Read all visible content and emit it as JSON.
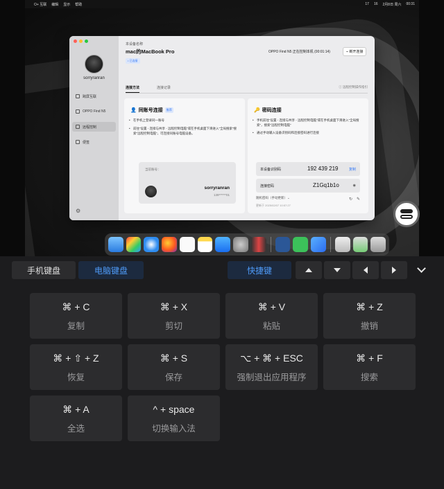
{
  "menubar": {
    "apple": "",
    "app": "O+ 互联",
    "menus": [
      "编辑",
      "显示",
      "帮助"
    ],
    "status": [
      "17",
      "16",
      "2月8日 周六",
      "00:31"
    ]
  },
  "window": {
    "device_label": "本设备名称",
    "device_name": "mac的MacBook Pro",
    "device_tag": "• 已连接",
    "control_status": "OPPO Find N5 正在控制本机 (00:01:14)",
    "disconnect_label": "⌁ 断开连接",
    "sidebar": {
      "user": "sorryranran",
      "items": [
        {
          "label": "跨屏互联"
        },
        {
          "label": "OPPO Find N5"
        },
        {
          "label": "远程控制"
        },
        {
          "label": "便签"
        }
      ]
    },
    "tabs": [
      "连接方法",
      "连接记录"
    ],
    "help": "ⓘ 远程控制操作指引",
    "same_account": {
      "title": "同账号连接",
      "badge": "推荐",
      "bullets": [
        "在手机上登录同一账号",
        "前往“设置 - 连接与共享 - 远程控制电脑”或在手机桌面下滑进入“全局搜索”搜索“远程控制电脑”，可连接同账号电脑设备。"
      ],
      "current_label": "当前账号：",
      "account_name": "sorryranran",
      "account_phone": "139******01"
    },
    "password": {
      "title": "密码连接",
      "bullets": [
        "手机前往“设置 - 连接与共享 - 远程控制电脑”或在手机桌面下滑进入“全局搜索”，搜索“远程控制电脑”",
        "通过手动输入设备识别码和连接密码进行连接"
      ],
      "id_label": "本设备识别码",
      "id_value": "192 439 219",
      "copy_label": "复制",
      "pw_label": "连接密码",
      "pw_value": "Z1Gq1b1o",
      "pw_option": "随机密码（手动更新）⌄",
      "pw_time": "更新于 2025/02/07 10:57:27"
    }
  },
  "toolbar": {
    "phone_keyboard": "手机键盘",
    "pc_keyboard": "电脑键盘",
    "shortcuts": "快捷键"
  },
  "keys": [
    {
      "combo": "⌘ + C",
      "desc": "复制"
    },
    {
      "combo": "⌘ + X",
      "desc": "剪切"
    },
    {
      "combo": "⌘ + V",
      "desc": "粘贴"
    },
    {
      "combo": "⌘ + Z",
      "desc": "撤销"
    },
    {
      "combo": "⌘ + ⇧ + Z",
      "desc": "恢复"
    },
    {
      "combo": "⌘ + S",
      "desc": "保存"
    },
    {
      "combo": "⌥ + ⌘ + ESC",
      "desc": "强制退出应用程序"
    },
    {
      "combo": "⌘ + F",
      "desc": "搜索"
    },
    {
      "combo": "⌘ + A",
      "desc": "全选"
    },
    {
      "combo": "^ + space",
      "desc": "切换输入法"
    }
  ],
  "colors": {
    "accent": "#4e9af7",
    "accent_bg": "#1c2a3f",
    "key_bg": "#2c2c2e",
    "panel_bg": "#1c1c1e"
  }
}
